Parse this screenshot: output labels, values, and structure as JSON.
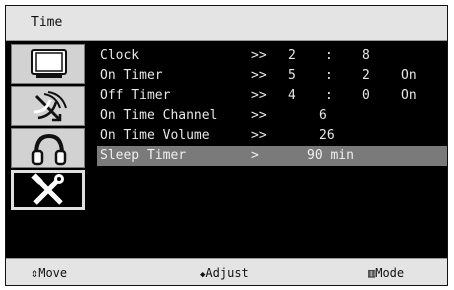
{
  "title": "Time",
  "menu": {
    "items": [
      {
        "label": "Clock",
        "arrow": ">>",
        "v1": "2",
        "sep": ":",
        "v2": "8",
        "v3": ""
      },
      {
        "label": "On Timer",
        "arrow": ">>",
        "v1": "5",
        "sep": ":",
        "v2": "2",
        "v3": "On"
      },
      {
        "label": "Off Timer",
        "arrow": ">>",
        "v1": "4",
        "sep": ":",
        "v2": "0",
        "v3": "On"
      },
      {
        "label": "On Time Channel",
        "arrow": ">>",
        "value": "6"
      },
      {
        "label": "On Time Volume",
        "arrow": ">>",
        "value": "26"
      },
      {
        "label": "Sleep Timer",
        "arrow": ">",
        "value": "90 min"
      }
    ]
  },
  "sidebar": {
    "icons": [
      {
        "name": "tv-picture-icon"
      },
      {
        "name": "antenna-channel-icon"
      },
      {
        "name": "headphones-sound-icon"
      },
      {
        "name": "tools-setup-icon"
      }
    ]
  },
  "footer": {
    "move_icon": "⇕",
    "move_label": "Move",
    "adjust_icon": "◆",
    "adjust_label": "Adjust",
    "mode_icon": "▥",
    "mode_label": "Mode"
  }
}
